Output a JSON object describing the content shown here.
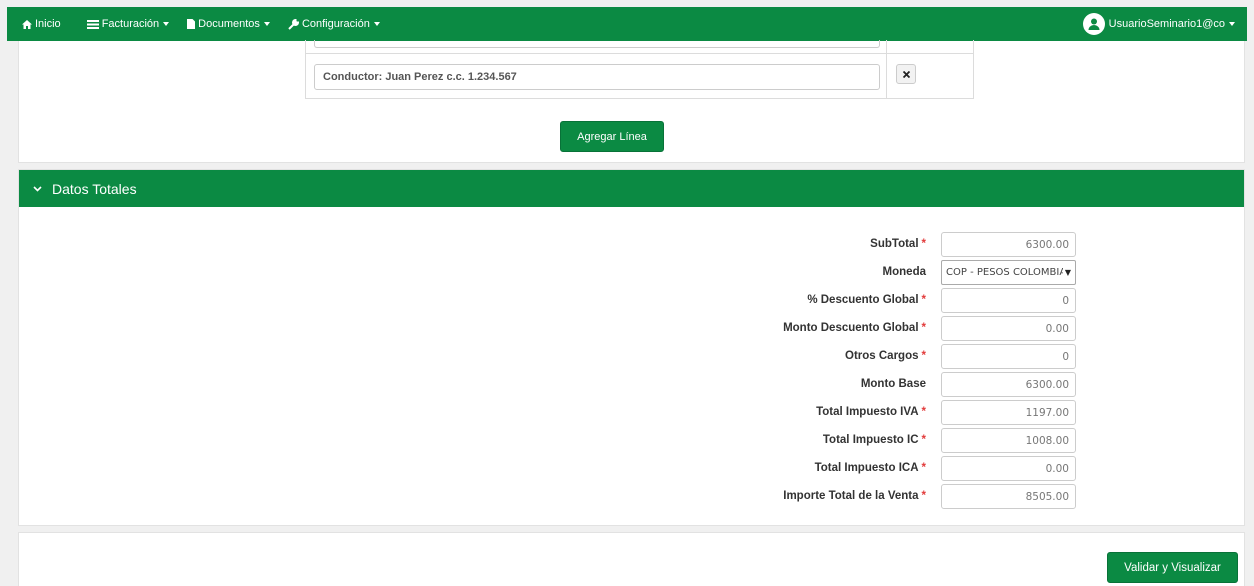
{
  "navbar": {
    "items": [
      {
        "label": "Inicio",
        "icon": "home-icon"
      },
      {
        "label": "Facturación",
        "icon": "list-icon"
      },
      {
        "label": "Documentos",
        "icon": "document-icon"
      },
      {
        "label": "Configuración",
        "icon": "wrench-icon"
      }
    ],
    "user": {
      "label": "UsuarioSeminario1@co",
      "icon": "user-icon"
    }
  },
  "lines": {
    "conductor_value": "Conductor: Juan Perez c.c. 1.234.567",
    "add_line_label": "Agregar Línea"
  },
  "totals": {
    "title": "Datos Totales",
    "fields": [
      {
        "label": "SubTotal",
        "value": "6300.00",
        "required": true
      },
      {
        "label": "Moneda",
        "value": "COP - PESOS COLOMBIANOS",
        "required": false,
        "type": "select"
      },
      {
        "label": "% Descuento Global",
        "value": "0",
        "required": true
      },
      {
        "label": "Monto Descuento Global",
        "value": "0.00",
        "required": true
      },
      {
        "label": "Otros Cargos",
        "value": "0",
        "required": true
      },
      {
        "label": "Monto Base",
        "value": "6300.00",
        "required": false
      },
      {
        "label": "Total Impuesto IVA",
        "value": "1197.00",
        "required": true
      },
      {
        "label": "Total Impuesto IC",
        "value": "1008.00",
        "required": true
      },
      {
        "label": "Total Impuesto ICA",
        "value": "0.00",
        "required": true
      },
      {
        "label": "Importe Total de la Venta",
        "value": "8505.00",
        "required": true
      }
    ],
    "required_mark": "*"
  },
  "actions": {
    "validate_label": "Validar y Visualizar"
  },
  "colors": {
    "brand": "#0b8a43",
    "required": "#e23b3b"
  }
}
